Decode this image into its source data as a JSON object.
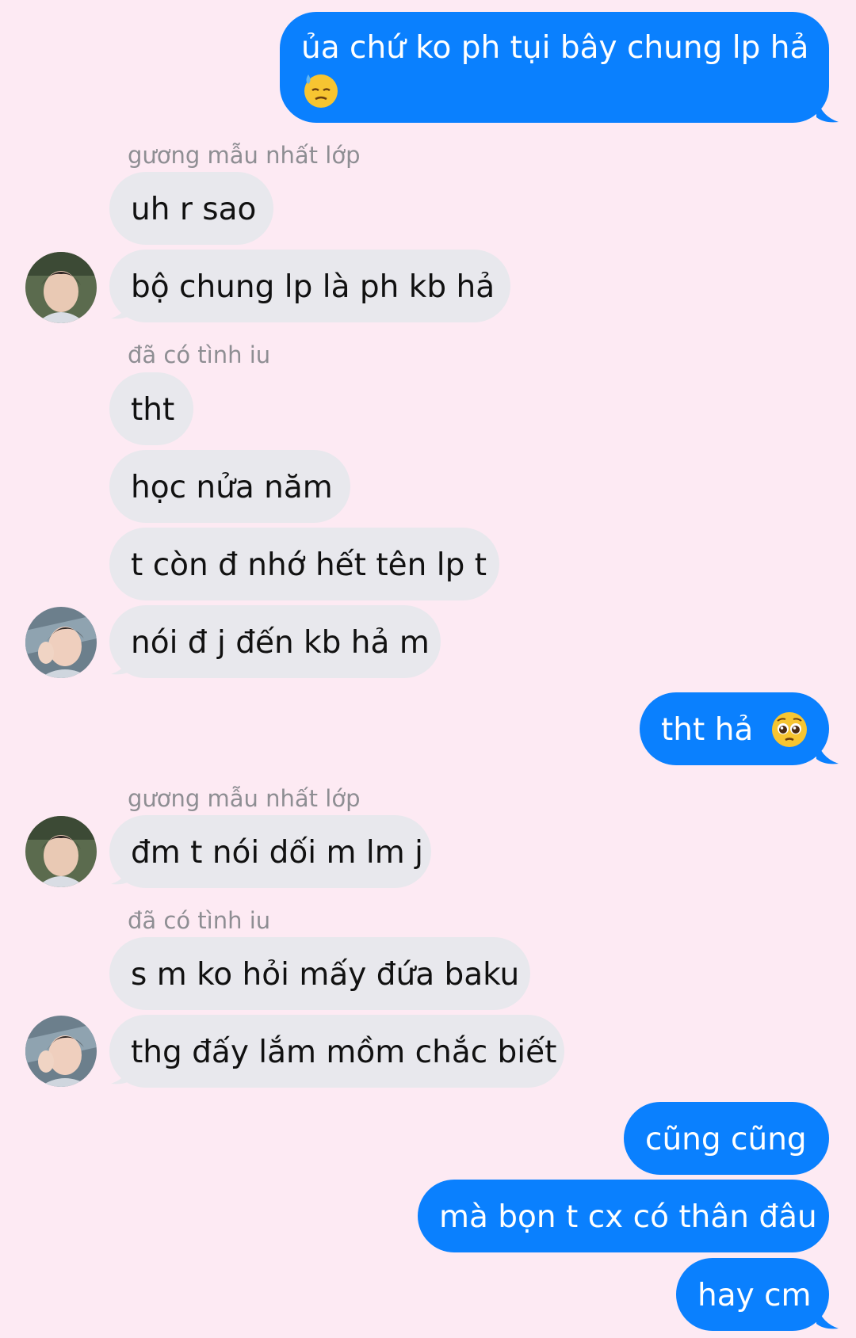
{
  "colors": {
    "background": "#fdeaf3",
    "sent_bubble": "#0a80fe",
    "received_bubble": "#e8e8ed",
    "sender_label": "#8e8e93"
  },
  "messages": {
    "m1": "ủa chứ ko ph tụi bây chung lp hả",
    "s1": "gương mẫu nhất lớp",
    "m2": "uh r sao",
    "m3": "bộ chung lp là ph kb hả",
    "s2": "đã có tình iu",
    "m4": "tht",
    "m5": "học nửa năm",
    "m6": "t còn đ nhớ hết tên lp t",
    "m7": "nói đ j đến kb hả m",
    "m8": "tht hả",
    "s3": "gương mẫu nhất lớp",
    "m9": "đm t nói dối m lm j",
    "s4": "đã có tình iu",
    "m10": "s m ko hỏi mấy đứa baku",
    "m11": "thg đấy lắm mồm chắc biết",
    "m12": "cũng cũng",
    "m13": "mà bọn t cx có thân đâu",
    "m14": "hay cm"
  },
  "icons": {
    "emoji_1": "downcast-face-with-sweat-emoji",
    "emoji_2": "pleading-face-emoji",
    "avatar": "profile-photo"
  }
}
